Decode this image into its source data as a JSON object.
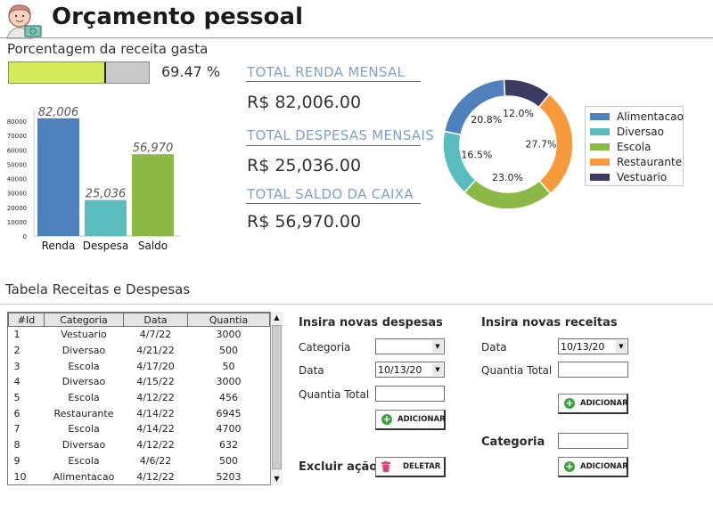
{
  "app": {
    "title": "Orçamento pessoal",
    "avatar_icon": "person-avatar-with-money-icon"
  },
  "progress": {
    "label": "Porcentagem da receita gasta",
    "value_text": "69.47 %",
    "fraction": 0.6947,
    "fill_color": "#d6ea59"
  },
  "chart_data": [
    {
      "type": "bar",
      "categories": [
        "Renda",
        "Despesa",
        "Saldo"
      ],
      "values": [
        82006,
        25036,
        56970
      ],
      "data_labels": [
        "82,006",
        "25,036",
        "56,970"
      ],
      "colors": [
        "#4f81bd",
        "#5bbcc0",
        "#8cb845"
      ],
      "ylim": [
        0,
        85000
      ],
      "yticks": [
        0,
        10000,
        20000,
        30000,
        40000,
        50000,
        60000,
        70000,
        80000
      ],
      "ytick_labels": [
        "0",
        "10000",
        "20000",
        "30000",
        "40000",
        "50000",
        "60000",
        "70000",
        "80000"
      ],
      "grid": false
    },
    {
      "type": "pie",
      "donut": true,
      "categories": [
        "Alimentacao",
        "Diversao",
        "Escola",
        "Restaurante",
        "Vestuario"
      ],
      "values": [
        20.8,
        16.5,
        23.0,
        27.7,
        12.0
      ],
      "labels": [
        "20.8%",
        "16.5%",
        "23.0%",
        "27.7%",
        "12.0%"
      ],
      "colors": [
        "#4f81bd",
        "#5bbcc0",
        "#8cb845",
        "#f79a3c",
        "#3b3b63"
      ],
      "legend": "right"
    }
  ],
  "totals": {
    "renda": {
      "label": "TOTAL RENDA MENSAL",
      "value": "R$ 82,006.00"
    },
    "despesas": {
      "label": "TOTAL DESPESAS MENSAIS",
      "value": "R$ 25,036.00"
    },
    "saldo": {
      "label": "TOTAL SALDO DA CAIXA",
      "value": "R$ 56,970.00"
    }
  },
  "table": {
    "title": "Tabela Receitas e Despesas",
    "columns": [
      "#Id",
      "Categoria",
      "Data",
      "Quantia"
    ],
    "rows": [
      [
        "1",
        "Vestuario",
        "4/7/22",
        "3000"
      ],
      [
        "2",
        "Diversao",
        "4/21/22",
        "500"
      ],
      [
        "3",
        "Escola",
        "4/17/20",
        "50"
      ],
      [
        "4",
        "Diversao",
        "4/15/22",
        "3000"
      ],
      [
        "5",
        "Escola",
        "4/12/22",
        "456"
      ],
      [
        "6",
        "Restaurante",
        "4/14/22",
        "6945"
      ],
      [
        "7",
        "Escola",
        "4/14/22",
        "4700"
      ],
      [
        "8",
        "Diversao",
        "4/12/22",
        "632"
      ],
      [
        "9",
        "Escola",
        "4/6/22",
        "500"
      ],
      [
        "10",
        "Alimentacao",
        "4/12/22",
        "5203"
      ]
    ],
    "scroll_up": "▲",
    "scroll_down": "▼"
  },
  "despesas_form": {
    "heading": "Insira novas despesas",
    "categoria_label": "Categoria",
    "categoria_value": "",
    "data_label": "Data",
    "data_value": "10/13/20",
    "quantia_label": "Quantia Total",
    "quantia_value": "",
    "add_button": "ADICIONAR",
    "delete_heading": "Excluir ação",
    "delete_button": "DELETAR"
  },
  "receitas_form": {
    "heading": "Insira novas receitas",
    "data_label": "Data",
    "data_value": "10/13/20",
    "quantia_label": "Quantia Total",
    "quantia_value": "",
    "add_button": "ADICIONAR",
    "categoria_label": "Categoria",
    "categoria_value": "",
    "add_button_2": "ADICIONAR"
  },
  "icons": {
    "dropdown": "▼",
    "plus": "+"
  }
}
